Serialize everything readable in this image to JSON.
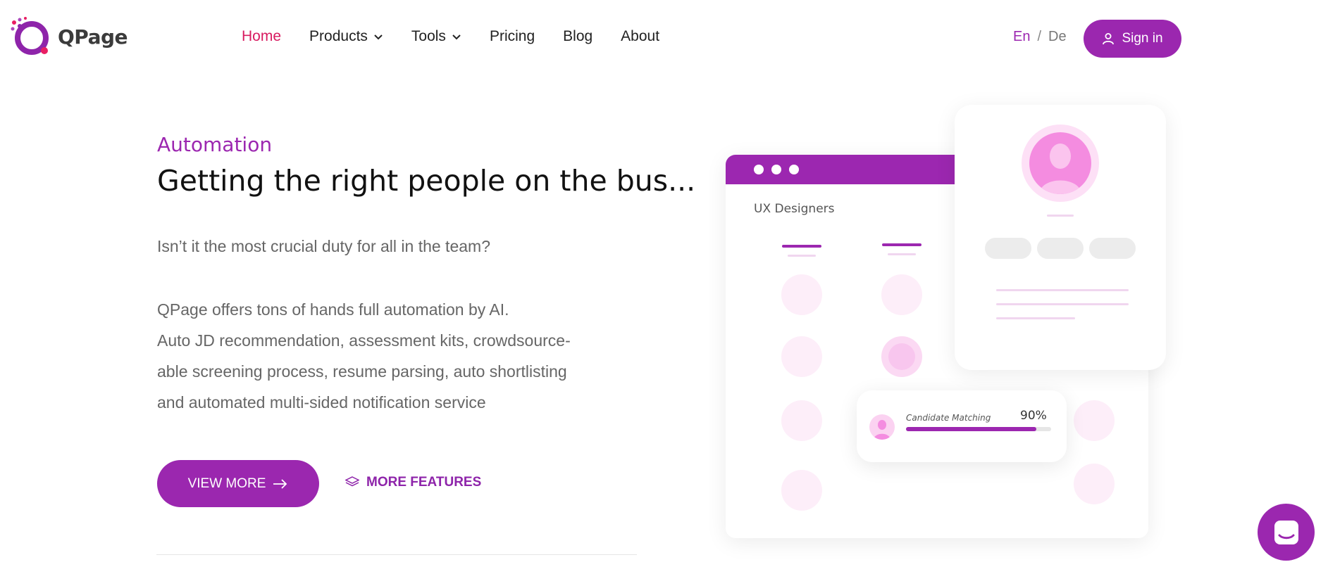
{
  "brand": {
    "name": "QPage",
    "accent": "#9c27b0",
    "active_color": "#d81b60"
  },
  "nav": {
    "items": [
      {
        "label": "Home",
        "active": true,
        "dropdown": false
      },
      {
        "label": "Products",
        "active": false,
        "dropdown": true
      },
      {
        "label": "Tools",
        "active": false,
        "dropdown": true
      },
      {
        "label": "Pricing",
        "active": false,
        "dropdown": false
      },
      {
        "label": "Blog",
        "active": false,
        "dropdown": false
      },
      {
        "label": "About",
        "active": false,
        "dropdown": false
      }
    ],
    "lang": {
      "current": "En",
      "separator": "/",
      "other": "De"
    },
    "signin_label": "Sign in",
    "signin_icon": "user-icon"
  },
  "hero": {
    "eyebrow": "Automation",
    "headline": "Getting the right people on the bus...",
    "lead": "Isn’t it the most crucial duty for all in the team?",
    "description_lines": [
      "QPage offers tons of hands full automation by AI.",
      "Auto JD recommendation, assessment kits, crowdsource-",
      "able screening process, resume parsing, auto shortlisting",
      "and automated multi-sided notification service"
    ],
    "view_more_label": "VIEW MORE",
    "view_more_icon": "arrow-right-icon",
    "more_features_label": "MORE FEATURES",
    "more_features_icon": "layers-icon"
  },
  "illustration": {
    "board_title": "UX Designers",
    "match": {
      "label": "Candidate Matching",
      "percent_text": "90%",
      "progress": 0.9
    }
  },
  "chat": {
    "icon": "chat-icon"
  }
}
